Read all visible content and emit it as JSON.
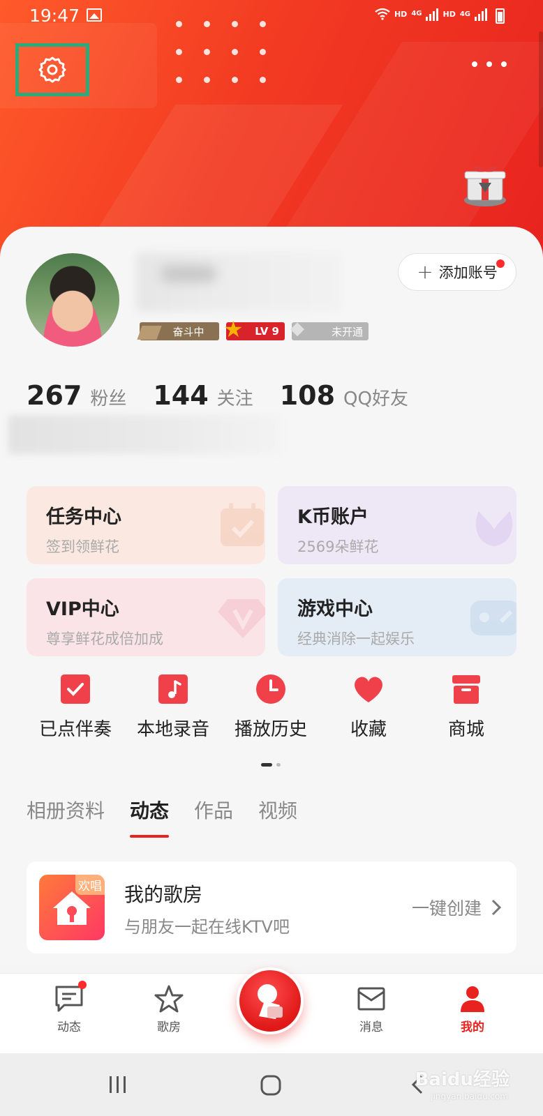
{
  "status_bar": {
    "time": "19:47",
    "net_label_1": "HD",
    "net_gen_1": "4G",
    "net_label_2": "HD",
    "net_gen_2": "4G"
  },
  "header": {
    "settings_icon": "gear-icon",
    "more_icon": "more-dots-icon",
    "gift_icon": "gift-box-icon"
  },
  "profile": {
    "add_account_label": "添加账号",
    "badges": {
      "fight": "奋斗中",
      "level": "LV 9",
      "vip": "未开通"
    },
    "stats": [
      {
        "value": "267",
        "label": "粉丝"
      },
      {
        "value": "144",
        "label": "关注"
      },
      {
        "value": "108",
        "label": "QQ好友"
      }
    ]
  },
  "tiles": [
    {
      "title": "任务中心",
      "subtitle": "签到领鲜花",
      "bg": "#fbe8e0",
      "icon": "calendar-check-icon"
    },
    {
      "title": "K币账户",
      "subtitle": "2569朵鲜花",
      "bg": "#eee7f6",
      "icon": "flower-icon"
    },
    {
      "title": "VIP中心",
      "subtitle": "尊享鲜花成倍加成",
      "bg": "#fbe4e8",
      "icon": "vip-diamond-icon"
    },
    {
      "title": "游戏中心",
      "subtitle": "经典消除一起娱乐",
      "bg": "#e4edf6",
      "icon": "gamepad-icon"
    }
  ],
  "quick_actions": [
    {
      "label": "已点伴奏",
      "icon": "checked-box-icon"
    },
    {
      "label": "本地录音",
      "icon": "music-note-icon"
    },
    {
      "label": "播放历史",
      "icon": "clock-icon"
    },
    {
      "label": "收藏",
      "icon": "heart-icon"
    },
    {
      "label": "商城",
      "icon": "shop-icon"
    }
  ],
  "tabs": [
    {
      "label": "相册资料",
      "active": false
    },
    {
      "label": "动态",
      "active": true
    },
    {
      "label": "作品",
      "active": false
    },
    {
      "label": "视频",
      "active": false
    }
  ],
  "room_card": {
    "badge": "欢唱",
    "title": "我的歌房",
    "subtitle": "与朋友一起在线KTV吧",
    "action": "一键创建"
  },
  "bottom_nav": [
    {
      "label": "动态",
      "icon": "message-icon",
      "active": false
    },
    {
      "label": "歌房",
      "icon": "star-icon",
      "active": false
    },
    {
      "label": "消息",
      "icon": "mail-icon",
      "active": false
    },
    {
      "label": "我的",
      "icon": "person-icon",
      "active": true
    }
  ],
  "watermark": {
    "text": "Baidu经验",
    "sub": "jingyan.baidu.com"
  },
  "colors": {
    "accent": "#e8231f",
    "header_start": "#ff5a2a",
    "highlight_box": "#2eaa7a"
  }
}
